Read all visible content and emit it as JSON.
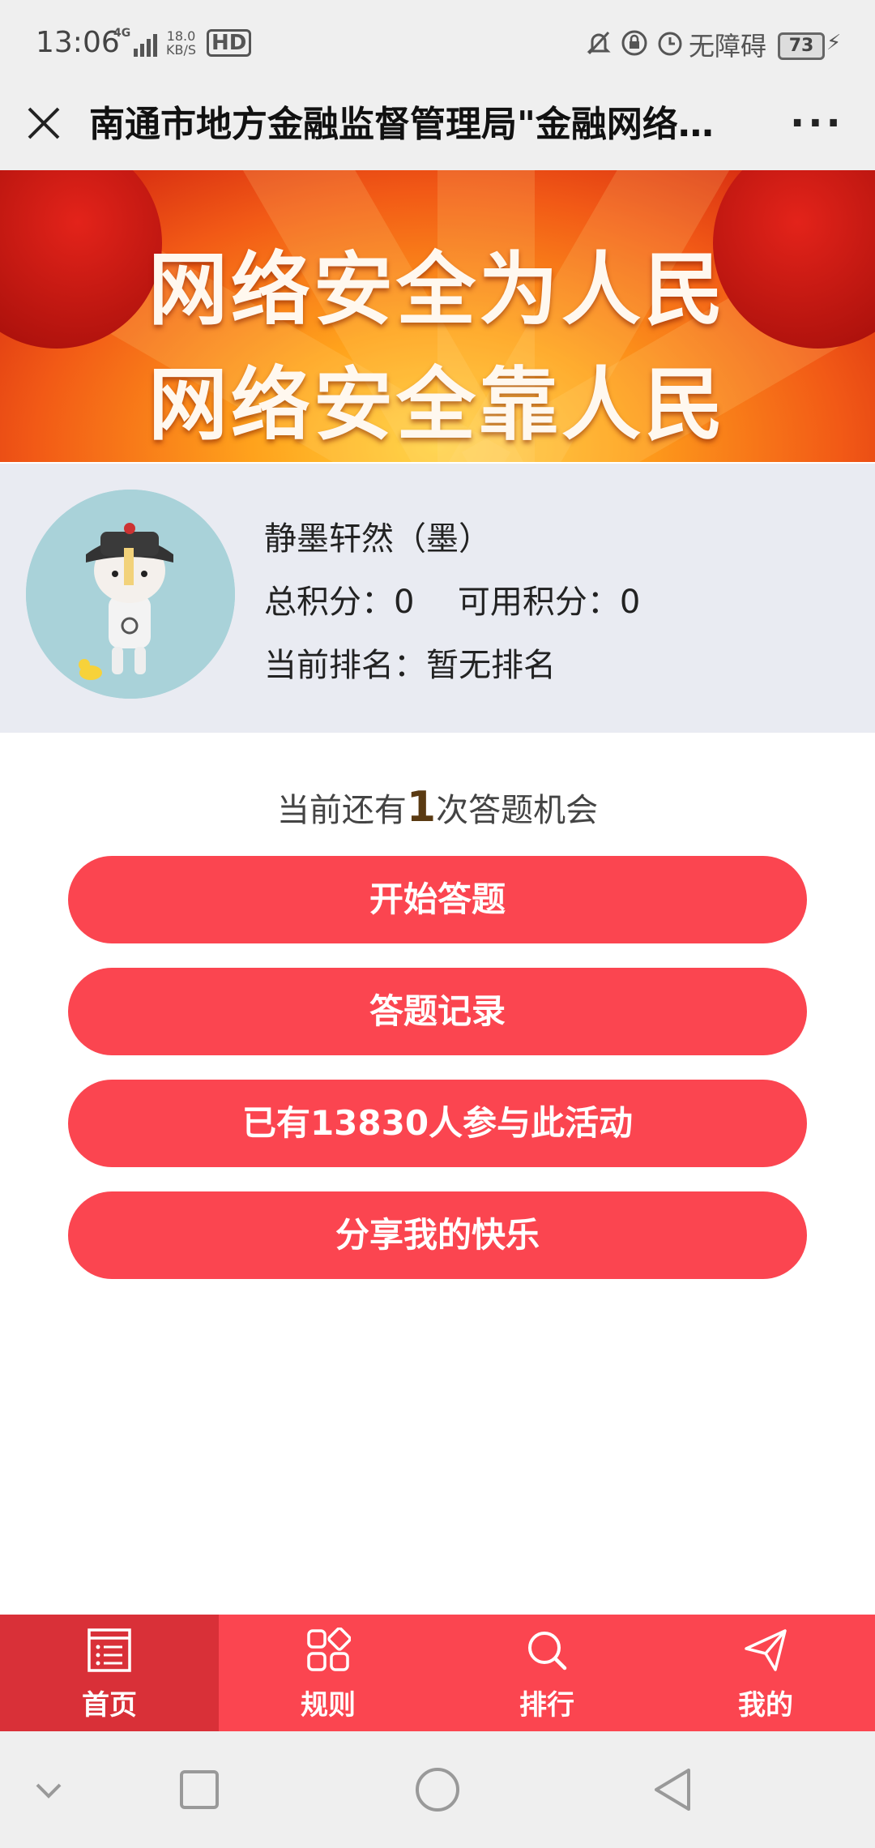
{
  "status_bar": {
    "time": "13:06",
    "network": "4G",
    "speed_top": "18.0",
    "speed_bottom": "KB/S",
    "hd": "HD",
    "accessibility": "无障碍",
    "battery": "73"
  },
  "titlebar": {
    "title": "南通市地方金融监督管理局\"金融网络…",
    "more_label": "···"
  },
  "banner": {
    "line1": "网络安全为人民",
    "line2": "网络安全靠人民"
  },
  "profile": {
    "name": "静墨轩然（墨）",
    "total_score_label": "总积分：",
    "total_score": "0",
    "available_score_label": "可用积分：",
    "available_score": "0",
    "rank_label": "当前排名：",
    "rank_value": "暂无排名"
  },
  "quiz": {
    "chances_prefix": "当前还有",
    "chances_count": "1",
    "chances_suffix": "次答题机会"
  },
  "buttons": {
    "start": "开始答题",
    "records": "答题记录",
    "participants": "已有13830人参与此活动",
    "share": "分享我的快乐"
  },
  "tabs": [
    {
      "label": "首页",
      "icon": "list-icon",
      "active": true
    },
    {
      "label": "规则",
      "icon": "grid-icon",
      "active": false
    },
    {
      "label": "排行",
      "icon": "search-icon",
      "active": false
    },
    {
      "label": "我的",
      "icon": "paper-plane-icon",
      "active": false
    }
  ],
  "colors": {
    "accent": "#fb4550",
    "active_tab": "#d93038",
    "profile_bg": "#e9ebf2"
  }
}
